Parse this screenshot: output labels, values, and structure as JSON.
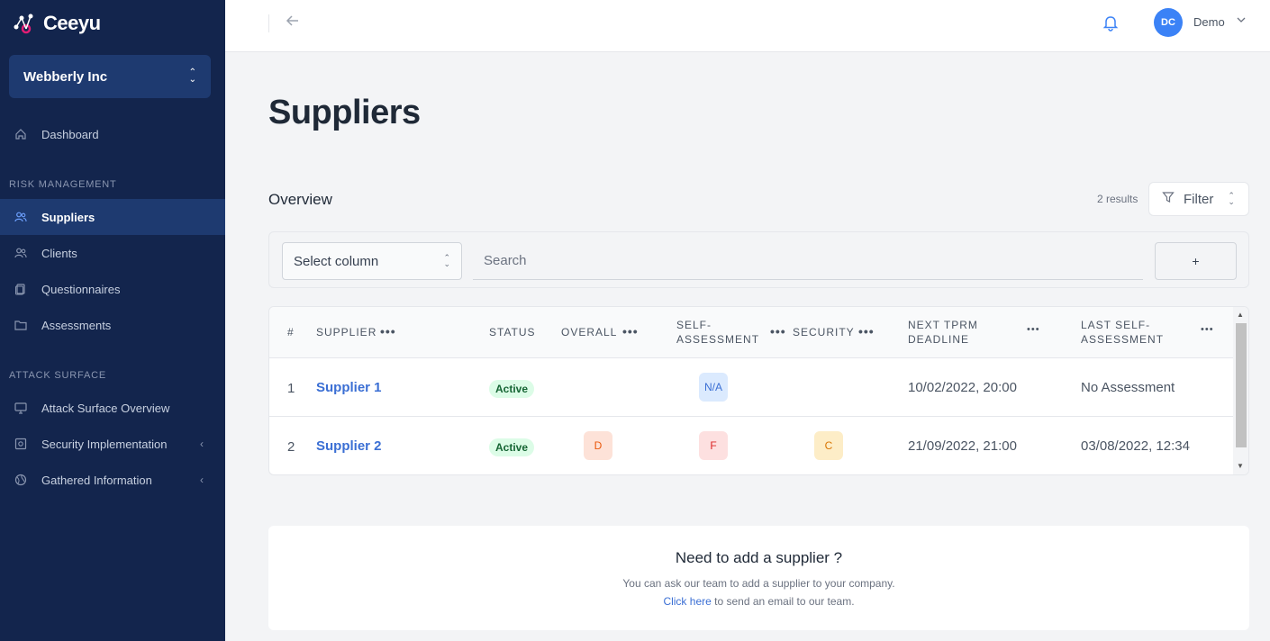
{
  "brand": {
    "name": "Ceeyu"
  },
  "org": {
    "name": "Webberly Inc"
  },
  "sidebar": {
    "dashboard": "Dashboard",
    "section_risk": "RISK MANAGEMENT",
    "suppliers": "Suppliers",
    "clients": "Clients",
    "questionnaires": "Questionnaires",
    "assessments": "Assessments",
    "section_attack": "ATTACK SURFACE",
    "attack_overview": "Attack Surface Overview",
    "security_impl": "Security Implementation",
    "gathered_info": "Gathered Information"
  },
  "user": {
    "initials": "DC",
    "name": "Demo"
  },
  "page": {
    "title": "Suppliers",
    "overview": "Overview",
    "results": "2 results",
    "filter": "Filter"
  },
  "search": {
    "column_placeholder": "Select column",
    "placeholder": "Search",
    "add_label": "+"
  },
  "table": {
    "headers": {
      "num": "#",
      "supplier": "SUPPLIER",
      "status": "STATUS",
      "overall": "OVERALL",
      "self_line1": "SELF-",
      "self_line2": "ASSESSMENT",
      "security": "SECURITY",
      "deadline_line1": "NEXT TPRM",
      "deadline_line2": "DEADLINE",
      "last_line1": "LAST SELF-",
      "last_line2": "ASSESSMENT",
      "dots": "•••"
    },
    "rows": [
      {
        "num": "1",
        "supplier": "Supplier 1",
        "status": "Active",
        "overall": "",
        "self": "N/A",
        "security": "",
        "deadline": "10/02/2022, 20:00",
        "last": "No Assessment"
      },
      {
        "num": "2",
        "supplier": "Supplier 2",
        "status": "Active",
        "overall": "D",
        "self": "F",
        "security": "C",
        "deadline": "21/09/2022, 21:00",
        "last": "03/08/2022, 12:34"
      }
    ]
  },
  "cta": {
    "title": "Need to add a supplier ?",
    "line1": "You can ask our team to add a supplier to your company.",
    "link": "Click here",
    "line2_rest": " to send an email to our team."
  },
  "colors": {
    "sidebar_bg": "#13254d",
    "accent": "#3b6fd4",
    "active_green": "#dcfce7"
  }
}
